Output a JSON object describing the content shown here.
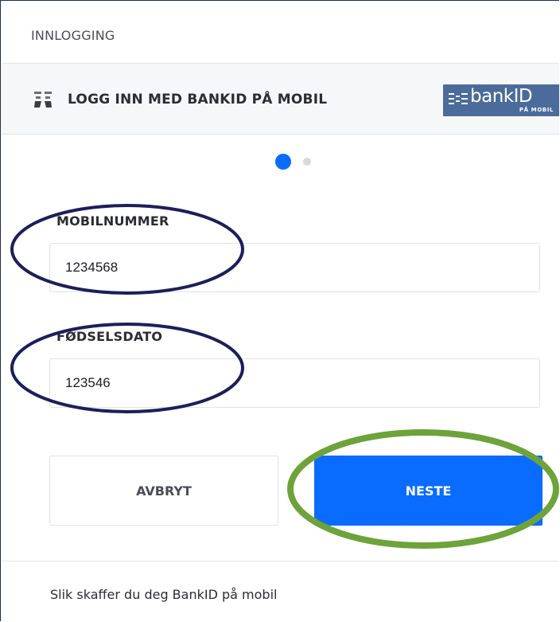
{
  "header": {
    "title": "INNLOGGING"
  },
  "method": {
    "icon": "bankid-mobile-icon",
    "label": "LOGG INN MED BANKID PÅ MOBIL",
    "logo_word": "bankID",
    "logo_sub": "PÅ MOBIL"
  },
  "steps": {
    "current": 1,
    "total": 2
  },
  "form": {
    "phone": {
      "label": "MOBILNUMMER",
      "value": "1234568"
    },
    "birthdate": {
      "label": "FØDSELSDATO",
      "value": "123546"
    }
  },
  "actions": {
    "cancel_label": "AVBRYT",
    "next_label": "NESTE"
  },
  "footer": {
    "help_link": "Slik skaffer du deg BankID på mobil"
  },
  "colors": {
    "primary": "#0a6cff",
    "logo_bg": "#4b6c9b",
    "annotation_navy": "#1b1f5a",
    "annotation_green": "#6da33a"
  }
}
